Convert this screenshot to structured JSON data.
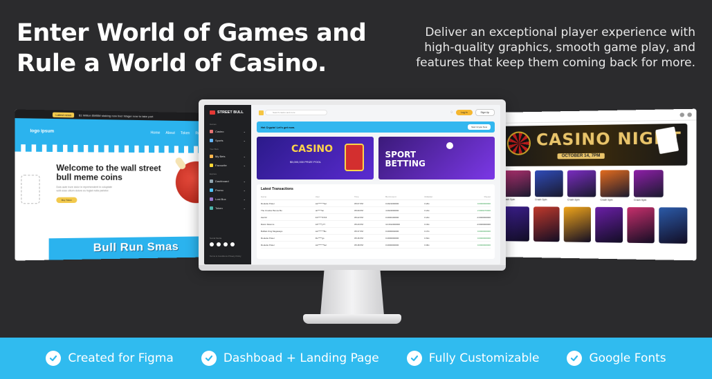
{
  "hero": {
    "headline": "Enter World of Games and Rule a World of Casino.",
    "subline": "Deliver an exceptional player experience with high-quality graphics, smooth game play, and features that keep them coming back for more."
  },
  "landing": {
    "topbar_badge": "Latest news",
    "topbar_text": "$1 Million $WBM staking now live! Wager now to take part",
    "logo": "logo ipsum",
    "nav": [
      "Home",
      "About",
      "Token",
      "Roadmap"
    ],
    "hero_title": "Welcome  to the wall street bull meme coins",
    "hero_text": "Duis aute irure dolor in reprehenderit in voluptate velit esse cillum dolore eu fugiat nulla pariatur.",
    "cta": "Buy Token",
    "banner": "Bull Run Smas"
  },
  "dashboard": {
    "logo": "STREET BULL",
    "sidebar": {
      "section_games": "Games",
      "items_games": [
        "Casino",
        "Sports"
      ],
      "section_bets": "Your Bets",
      "items_bets": [
        "My Bets",
        "Favourite"
      ],
      "section_explore": "Explore",
      "items_explore": [
        "Dashboard",
        "Promo",
        "Lost Box",
        "Token"
      ],
      "social_label": "Social Media",
      "footer": "Terms & Conditions    Privacy Policy"
    },
    "search_placeholder": "Search casino and more",
    "login": "Log In",
    "signup": "Sign Up",
    "welcome": "Hei Crypto! Let's get now.",
    "welcome_button": "Start Crypto Now",
    "promo_casino": "CASINO",
    "promo_casino_sub": "$5,000,000 PRIZE POOL",
    "promo_sport_line1": "SPORT",
    "promo_sport_line2": "BETTING",
    "transactions_title": "Latest Transactions",
    "columns": [
      "Game",
      "User",
      "Time",
      "Bet Amount",
      "Multiplier",
      "Payout"
    ],
    "rows": [
      {
        "game": "Roulette Poker",
        "user": "Lik*******bel",
        "time": "05:07 PM",
        "bet": "0.0021000000",
        "mult": "0.20x",
        "payout": "0.0000000000",
        "positive": true
      },
      {
        "game": "The Crusher Bonus Bu",
        "user": "ok*****ler",
        "time": "05:09 PM",
        "bet": "4.0022000000",
        "mult": "0.24x",
        "payout": "2.0000270000",
        "positive": true
      },
      {
        "game": "ZenX2",
        "user": "KX*****0715",
        "time": "05:22 PM",
        "bet": "0.0000100000",
        "mult": "0.22x",
        "payout": "-0.0000000000",
        "positive": false
      },
      {
        "game": "Razor Returns",
        "user": "Ab*****y77",
        "time": "05:20 PM",
        "bet": "14.0012000000",
        "mult": "0.43x",
        "payout": "-0.0000000000",
        "positive": false
      },
      {
        "game": "Buffalo King Megaways",
        "user": "Lik*******Bu",
        "time": "05:37 PM",
        "bet": "0.0000002000",
        "mult": "0.47x",
        "payout": "0.0000000000",
        "positive": true
      },
      {
        "game": "Roulette Poker",
        "user": "Ro*****gs",
        "time": "05:46 PM",
        "bet": "0.0000000000",
        "mult": "0.62x",
        "payout": "0.0000000000",
        "positive": true
      },
      {
        "game": "Roulette Poker",
        "user": "Lik*******bel",
        "time": "05:48 PM",
        "bet": "0.0000000000",
        "mult": "0.00x",
        "payout": "0.0000000000",
        "positive": true
      }
    ]
  },
  "casino_site": {
    "banner_title": "CASINO NIGHT",
    "banner_date": "OCTOBER 14, 7PM",
    "row1_captions": [
      "Crash Spin",
      "Crash Spin",
      "Crash Spin",
      "Crash Spin",
      "Crash Spin"
    ],
    "row1_colors": [
      "#b0306f",
      "#2f4bb8",
      "#7a2cc0",
      "#e26b1e",
      "#8e1fa8"
    ],
    "row2_colors": [
      "#3c1f8f",
      "#c0392b",
      "#f0a51a",
      "#6a1fa6",
      "#c62f6b",
      "#2b5aa8"
    ]
  },
  "features": [
    {
      "label": "Created for Figma"
    },
    {
      "label": "Dashboad + Landing Page"
    },
    {
      "label": "Fully Customizable"
    },
    {
      "label": "Google Fonts"
    }
  ],
  "colors": {
    "accent": "#30bbef",
    "gold": "#f5b731",
    "background": "#2b2b2d"
  }
}
